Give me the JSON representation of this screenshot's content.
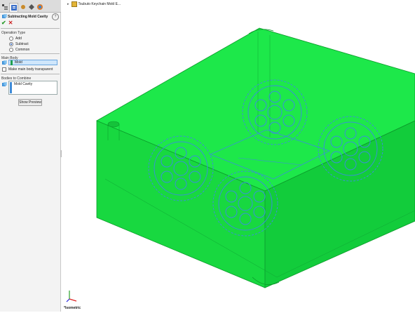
{
  "feature": {
    "title": "Subtracting Mold Cavity",
    "ok_symbol": "✔",
    "cancel_symbol": "✕",
    "help_symbol": "?"
  },
  "operation": {
    "title": "Operation Type",
    "options": [
      {
        "label": "Add",
        "selected": false
      },
      {
        "label": "Subtract",
        "selected": true
      },
      {
        "label": "Common",
        "selected": false
      }
    ]
  },
  "main_body": {
    "title": "Main Body",
    "value": "Mold",
    "transparent_label": "Make main body transparent",
    "transparent_checked": false
  },
  "combine": {
    "title": "Bodies to Combine",
    "items": [
      "Mold Cavity"
    ]
  },
  "preview_button": "Show Preview",
  "tree": {
    "root_label": "Tsubuto Keychain Mold E..."
  },
  "view": {
    "label": "*Isometric"
  },
  "colors": {
    "model_green": "#1de84a",
    "cavity_blue": "#3a8fd8",
    "accent": "#1f56b5"
  }
}
